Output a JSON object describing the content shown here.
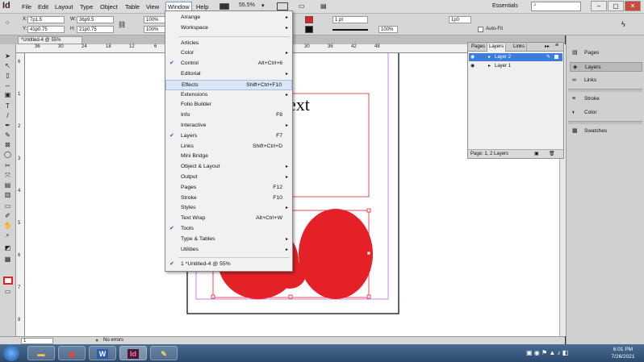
{
  "app": {
    "logo": "Id"
  },
  "menubar": {
    "items": [
      "File",
      "Edit",
      "Layout",
      "Type",
      "Object",
      "Table",
      "View",
      "Window",
      "Help"
    ],
    "zoom": "55.5%",
    "workspace": "Essentials",
    "window_controls": [
      "–",
      "▢",
      "✕"
    ]
  },
  "control": {
    "x_label": "X:",
    "x_value": "7p1.5",
    "y_label": "Y:",
    "y_value": "41p0.75",
    "w_label": "W:",
    "w_value": "36p9.5",
    "h_label": "H:",
    "h_value": "21p0.75",
    "scale_x": "100%",
    "scale_y": "100%",
    "stroke_weight": "1 pt",
    "opacity": "100%",
    "offset": "1p0",
    "auto_fit": "Auto-Fit"
  },
  "document": {
    "tab_title": "*Untitled-4 @ 55%",
    "ruler_ticks": [
      "36",
      "30",
      "24",
      "18",
      "12",
      "6",
      "0",
      "6",
      "12",
      "18",
      "24",
      "30",
      "36",
      "42",
      "48"
    ],
    "vruler_ticks": [
      "6",
      "1",
      "2",
      "3",
      "4",
      "5",
      "6",
      "7",
      "8"
    ],
    "page_text": "ext",
    "fill_color": "#e32127"
  },
  "status": {
    "page": "1",
    "preflight": "No errors"
  },
  "window_menu": {
    "items": [
      {
        "label": "Arrange",
        "shortcut": "",
        "submenu": true,
        "checked": false
      },
      {
        "label": "Workspace",
        "shortcut": "",
        "submenu": true,
        "checked": false
      },
      {
        "label": "Articles",
        "shortcut": "",
        "submenu": false,
        "checked": false
      },
      {
        "label": "Color",
        "shortcut": "",
        "submenu": true,
        "checked": false
      },
      {
        "label": "Control",
        "shortcut": "Alt+Ctrl+6",
        "submenu": false,
        "checked": true
      },
      {
        "label": "Editorial",
        "shortcut": "",
        "submenu": true,
        "checked": false
      },
      {
        "label": "Effects",
        "shortcut": "Shift+Ctrl+F10",
        "submenu": false,
        "checked": false
      },
      {
        "label": "Extensions",
        "shortcut": "",
        "submenu": true,
        "checked": false
      },
      {
        "label": "Folio Builder",
        "shortcut": "",
        "submenu": false,
        "checked": false
      },
      {
        "label": "Info",
        "shortcut": "F8",
        "submenu": false,
        "checked": false
      },
      {
        "label": "Interactive",
        "shortcut": "",
        "submenu": true,
        "checked": false
      },
      {
        "label": "Layers",
        "shortcut": "F7",
        "submenu": false,
        "checked": true
      },
      {
        "label": "Links",
        "shortcut": "Shift+Ctrl+D",
        "submenu": false,
        "checked": false
      },
      {
        "label": "Mini Bridge",
        "shortcut": "",
        "submenu": false,
        "checked": false
      },
      {
        "label": "Object & Layout",
        "shortcut": "",
        "submenu": true,
        "checked": false
      },
      {
        "label": "Output",
        "shortcut": "",
        "submenu": true,
        "checked": false
      },
      {
        "label": "Pages",
        "shortcut": "F12",
        "submenu": false,
        "checked": false
      },
      {
        "label": "Stroke",
        "shortcut": "F10",
        "submenu": false,
        "checked": false
      },
      {
        "label": "Styles",
        "shortcut": "",
        "submenu": true,
        "checked": false
      },
      {
        "label": "Text Wrap",
        "shortcut": "Alt+Ctrl+W",
        "submenu": false,
        "checked": false
      },
      {
        "label": "Tools",
        "shortcut": "",
        "submenu": false,
        "checked": true
      },
      {
        "label": "Type & Tables",
        "shortcut": "",
        "submenu": true,
        "checked": false
      },
      {
        "label": "Utilities",
        "shortcut": "",
        "submenu": true,
        "checked": false
      },
      {
        "label": "1 *Untitled-4 @ 55%",
        "shortcut": "",
        "submenu": false,
        "checked": true
      }
    ],
    "highlighted": "Effects"
  },
  "layers_panel": {
    "tabs": [
      "Pages",
      "Layers",
      "Links"
    ],
    "layers": [
      {
        "name": "Layer 2",
        "selected": true
      },
      {
        "name": "Layer 1",
        "selected": false
      }
    ],
    "footer": "Page: 1, 2 Layers"
  },
  "right_panel": {
    "items": [
      "Pages",
      "Layers",
      "Links",
      "Stroke",
      "Color",
      "Swatches"
    ]
  },
  "taskbar": {
    "time": "6:01 PM",
    "date": "7/26/2021"
  }
}
